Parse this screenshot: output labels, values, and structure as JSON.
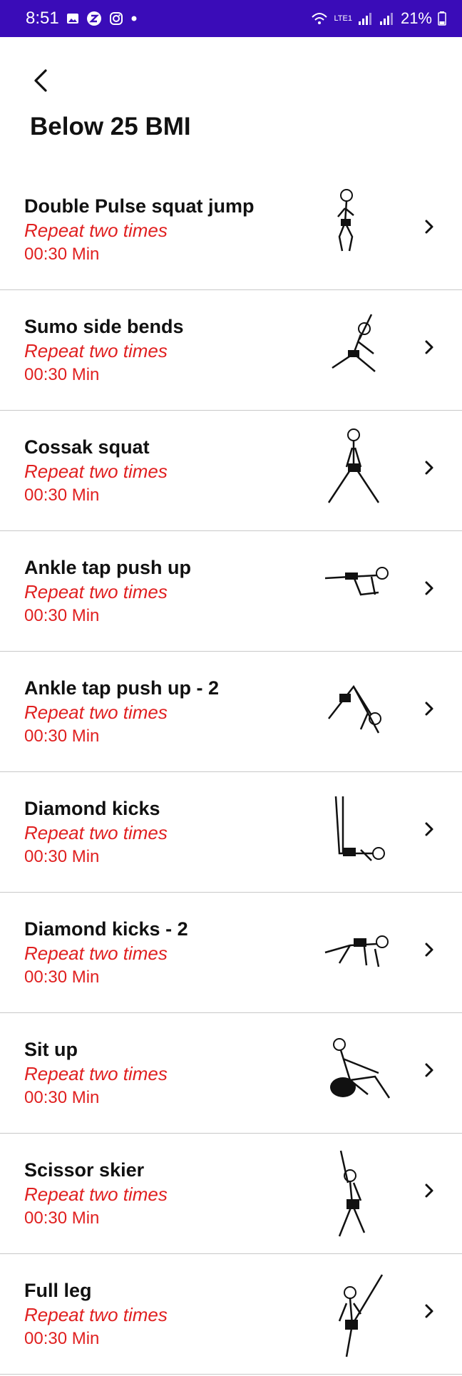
{
  "status_bar": {
    "time": "8:51",
    "battery": "21%",
    "network": "LTE1"
  },
  "header": {
    "title": "Below 25 BMI"
  },
  "exercises": [
    {
      "name": "Double Pulse squat jump",
      "repeat": "Repeat two times",
      "duration": "00:30 Min"
    },
    {
      "name": "Sumo side bends",
      "repeat": "Repeat two times",
      "duration": "00:30 Min"
    },
    {
      "name": "Cossak squat",
      "repeat": "Repeat two times",
      "duration": "00:30 Min"
    },
    {
      "name": "Ankle tap push up",
      "repeat": "Repeat two times",
      "duration": "00:30 Min"
    },
    {
      "name": "Ankle tap push up - 2",
      "repeat": "Repeat two times",
      "duration": "00:30 Min"
    },
    {
      "name": "Diamond kicks",
      "repeat": "Repeat two times",
      "duration": "00:30 Min"
    },
    {
      "name": "Diamond kicks - 2",
      "repeat": "Repeat two times",
      "duration": "00:30 Min"
    },
    {
      "name": "Sit up",
      "repeat": "Repeat two times",
      "duration": "00:30 Min"
    },
    {
      "name": "Scissor skier",
      "repeat": "Repeat two times",
      "duration": "00:30 Min"
    },
    {
      "name": "Full leg",
      "repeat": "Repeat two times",
      "duration": "00:30 Min"
    }
  ],
  "colors": {
    "status_bar": "#3a0cb8",
    "accent_red": "#e02020"
  }
}
